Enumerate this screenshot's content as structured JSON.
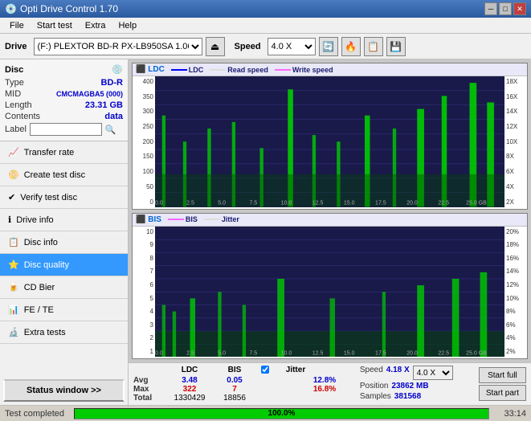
{
  "app": {
    "title": "Opti Drive Control 1.70",
    "title_icon": "💿"
  },
  "titlebar": {
    "minimize": "─",
    "maximize": "□",
    "close": "✕"
  },
  "menu": {
    "items": [
      "File",
      "Start test",
      "Extra",
      "Help"
    ]
  },
  "toolbar": {
    "drive_label": "Drive",
    "drive_value": "(F:)  PLEXTOR BD-R  PX-LB950SA 1.06",
    "speed_label": "Speed",
    "speed_value": "4.0 X"
  },
  "disc": {
    "label": "Disc",
    "type_key": "Type",
    "type_value": "BD-R",
    "mid_key": "MID",
    "mid_value": "CMCMAGBA5 (000)",
    "length_key": "Length",
    "length_value": "23.31 GB",
    "contents_key": "Contents",
    "contents_value": "data",
    "label_key": "Label",
    "label_value": ""
  },
  "nav": {
    "items": [
      {
        "id": "transfer-rate",
        "label": "Transfer rate",
        "icon": "📈"
      },
      {
        "id": "create-test-disc",
        "label": "Create test disc",
        "icon": "📀"
      },
      {
        "id": "verify-test-disc",
        "label": "Verify test disc",
        "icon": "✔"
      },
      {
        "id": "drive-info",
        "label": "Drive info",
        "icon": "ℹ"
      },
      {
        "id": "disc-info",
        "label": "Disc info",
        "icon": "📋"
      },
      {
        "id": "disc-quality",
        "label": "Disc quality",
        "icon": "⭐",
        "active": true
      },
      {
        "id": "cd-bier",
        "label": "CD Bier",
        "icon": "🍺"
      },
      {
        "id": "fe-te",
        "label": "FE / TE",
        "icon": "📊"
      },
      {
        "id": "extra-tests",
        "label": "Extra tests",
        "icon": "🔬"
      }
    ],
    "status_btn": "Status window >>"
  },
  "disc_quality": {
    "title": "Disc quality",
    "chart1": {
      "title": "LDC",
      "legend": [
        {
          "label": "LDC",
          "color": "#0000ff"
        },
        {
          "label": "Read speed",
          "color": "#ffffff"
        },
        {
          "label": "Write speed",
          "color": "#ff00ff"
        }
      ],
      "y_left": [
        "400",
        "350",
        "300",
        "250",
        "200",
        "150",
        "100",
        "50",
        "0"
      ],
      "y_right": [
        "18X",
        "16X",
        "14X",
        "12X",
        "10X",
        "8X",
        "6X",
        "4X",
        "2X"
      ],
      "x_labels": [
        "0.0",
        "2.5",
        "5.0",
        "7.5",
        "10.0",
        "12.5",
        "15.0",
        "17.5",
        "20.0",
        "22.5",
        "25.0 GB"
      ]
    },
    "chart2": {
      "title": "BIS",
      "legend": [
        {
          "label": "BIS",
          "color": "#ff00ff"
        },
        {
          "label": "Jitter",
          "color": "#ffffff"
        }
      ],
      "y_left": [
        "10",
        "9",
        "8",
        "7",
        "6",
        "5",
        "4",
        "3",
        "2",
        "1"
      ],
      "y_right": [
        "20%",
        "18%",
        "16%",
        "14%",
        "12%",
        "10%",
        "8%",
        "6%",
        "4%",
        "2%"
      ],
      "x_labels": [
        "0.0",
        "2.5",
        "5.0",
        "7.5",
        "10.0",
        "12.5",
        "15.0",
        "17.5",
        "20.0",
        "22.5",
        "25.0 GB"
      ]
    }
  },
  "stats": {
    "headers": [
      "",
      "LDC",
      "BIS",
      "",
      "Jitter",
      "Speed",
      ""
    ],
    "avg_label": "Avg",
    "avg_ldc": "3.48",
    "avg_bis": "0.05",
    "avg_jitter": "12.8%",
    "max_label": "Max",
    "max_ldc": "322",
    "max_bis": "7",
    "max_jitter": "16.8%",
    "total_label": "Total",
    "total_ldc": "1330429",
    "total_bis": "18856",
    "speed_current": "4.18 X",
    "speed_select": "4.0 X",
    "position_label": "Position",
    "position_value": "23862 MB",
    "samples_label": "Samples",
    "samples_value": "381568",
    "btn_start_full": "Start full",
    "btn_start_part": "Start part"
  },
  "progress": {
    "status": "Test completed",
    "percent": "100.0%",
    "percent_num": 100,
    "time": "33:14"
  }
}
